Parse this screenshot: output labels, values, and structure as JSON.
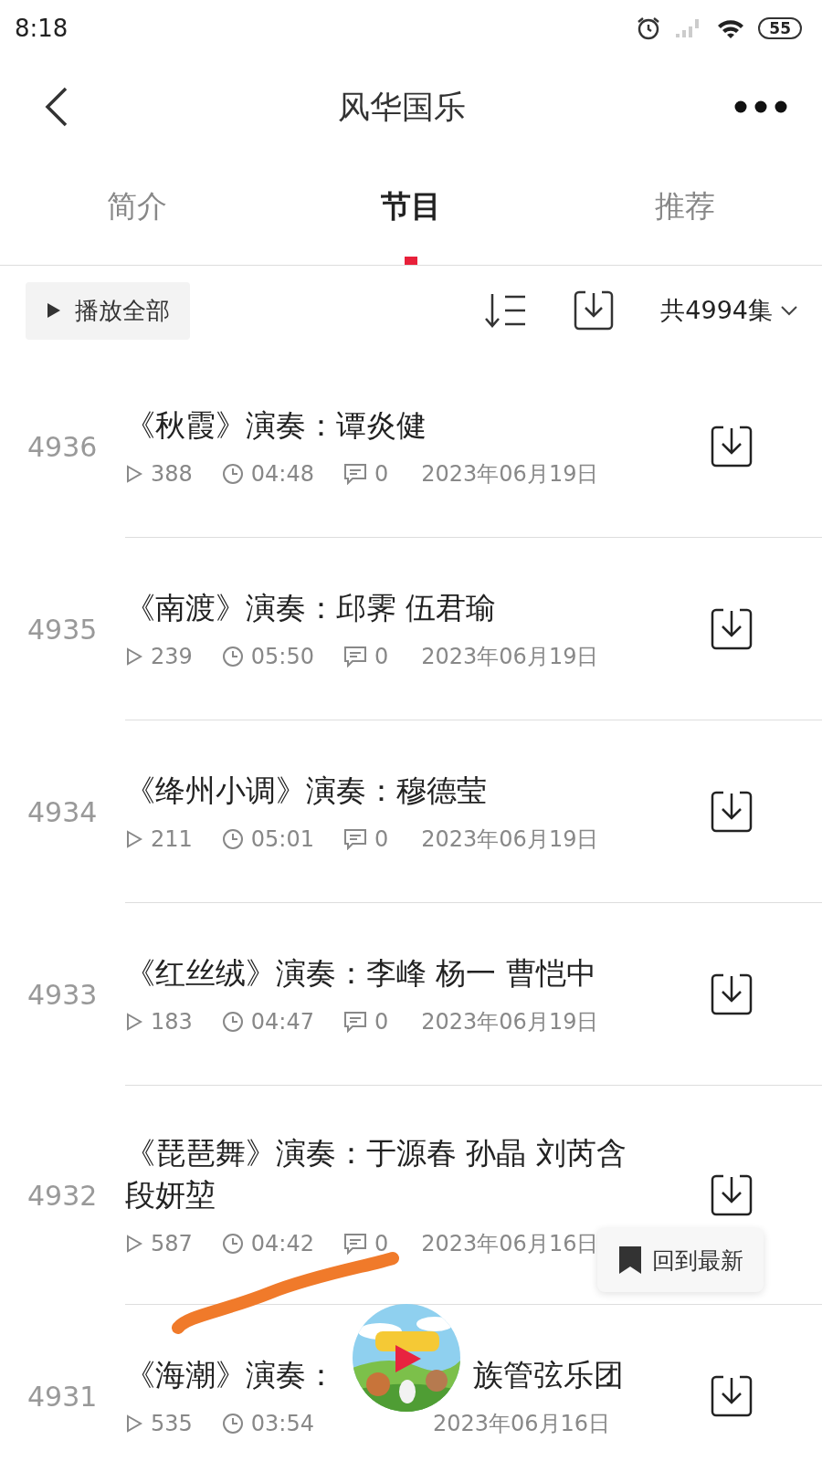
{
  "status_bar": {
    "time": "8:18",
    "battery": "55"
  },
  "header": {
    "title": "风华国乐"
  },
  "tabs": [
    {
      "label": "简介",
      "selected": false
    },
    {
      "label": "节目",
      "selected": true
    },
    {
      "label": "推荐",
      "selected": false
    }
  ],
  "toolbar": {
    "play_all": "播放全部",
    "count": "共4994集"
  },
  "episodes": [
    {
      "number": "4936",
      "title": "《秋霞》演奏：谭炎健",
      "plays": "388",
      "duration": "04:48",
      "comments": "0",
      "date": "2023年06月19日"
    },
    {
      "number": "4935",
      "title": "《南渡》演奏：邱霁 伍君瑜",
      "plays": "239",
      "duration": "05:50",
      "comments": "0",
      "date": "2023年06月19日"
    },
    {
      "number": "4934",
      "title": "《绛州小调》演奏：穆德莹",
      "plays": "211",
      "duration": "05:01",
      "comments": "0",
      "date": "2023年06月19日"
    },
    {
      "number": "4933",
      "title": "《红丝绒》演奏：李峰 杨一 曹恺中",
      "plays": "183",
      "duration": "04:47",
      "comments": "0",
      "date": "2023年06月19日"
    },
    {
      "number": "4932",
      "title": "《琵琶舞》演奏：于源春 孙晶 刘芮含段妍堃",
      "plays": "587",
      "duration": "04:42",
      "comments": "0",
      "date": "2023年06月16日"
    },
    {
      "number": "4931",
      "title_parts": [
        "《海潮》演奏：",
        "族管弦乐团"
      ],
      "plays": "535",
      "duration": "03:54",
      "date": "2023年06月16日"
    }
  ],
  "back_to_latest": "回到最新"
}
